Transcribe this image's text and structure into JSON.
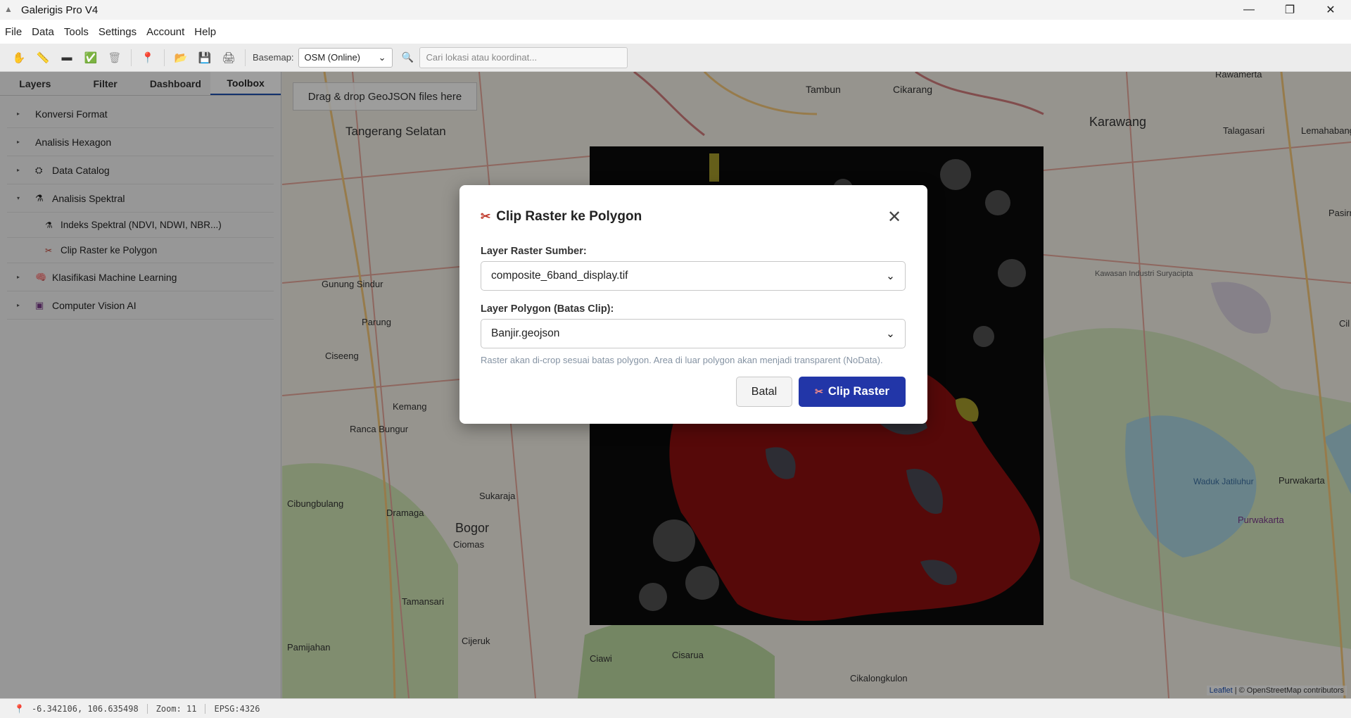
{
  "window": {
    "title": "Galerigis Pro V4",
    "minimize": "—",
    "maximize": "❐",
    "close": "✕"
  },
  "menu": [
    "File",
    "Data",
    "Tools",
    "Settings",
    "Account",
    "Help"
  ],
  "toolbar": {
    "basemap_label": "Basemap:",
    "basemap_value": "OSM (Online)",
    "search_placeholder": "Cari lokasi atau koordinat..."
  },
  "sidebar": {
    "tabs": [
      "Layers",
      "Filter",
      "Dashboard",
      "Toolbox"
    ],
    "active_tab": "Toolbox",
    "items": [
      {
        "label": "Konversi Format",
        "arrow": "▸"
      },
      {
        "label": "Analisis Hexagon",
        "arrow": "▸"
      },
      {
        "label": "Data Catalog",
        "arrow": "▸",
        "icon": "⛭"
      },
      {
        "label": "Analisis Spektral",
        "arrow": "▾",
        "icon": "⚗"
      },
      {
        "label": "Klasifikasi Machine Learning",
        "arrow": "▸",
        "icon": "🧠"
      },
      {
        "label": "Computer Vision AI",
        "arrow": "▸",
        "icon": "▣"
      }
    ],
    "subitems": [
      {
        "label": "Indeks Spektral (NDVI, NDWI, NBR...)",
        "icon": "⚗"
      },
      {
        "label": "Clip Raster ke Polygon",
        "icon": "✂"
      }
    ]
  },
  "map": {
    "dropzone": "Drag & drop GeoJSON files here",
    "attribution_leaflet": "Leaflet",
    "attribution_rest": " | © OpenStreetMap contributors",
    "labels": [
      "Tangerang Selatan",
      "Karawang",
      "Bogor",
      "Tambun",
      "Cikarang",
      "Parung",
      "Gunung Sindur",
      "Ciseeng",
      "Kemang",
      "Ranca Bungur",
      "Cibungbulang",
      "Dramaga",
      "Ciomas",
      "Tamansari",
      "Cijeruk",
      "Ciawi",
      "Cisarua",
      "Sukaraja",
      "Pamijahan",
      "Cikalongkulon",
      "Purwakarta",
      "Purwakarta",
      "Talagasari",
      "Lemahabang",
      "Rawamerta",
      "Kawasan Industri Suryacipta",
      "Waduk Jatiluhur",
      "Pasirm",
      "Cil"
    ]
  },
  "status": {
    "coords": "-6.342106, 106.635498",
    "zoom": "Zoom: 11",
    "epsg": "EPSG:4326"
  },
  "dialog": {
    "title": "Clip Raster ke Polygon",
    "raster_label": "Layer Raster Sumber:",
    "raster_value": "composite_6band_display.tif",
    "polygon_label": "Layer Polygon (Batas Clip):",
    "polygon_value": "Banjir.geojson",
    "hint": "Raster akan di-crop sesuai batas polygon. Area di luar polygon akan menjadi transparent (NoData).",
    "cancel": "Batal",
    "submit": "Clip Raster"
  },
  "colors": {
    "accent": "#2236a8",
    "flood_red": "#8b1010",
    "raster_bg": "#0d0d0d"
  }
}
